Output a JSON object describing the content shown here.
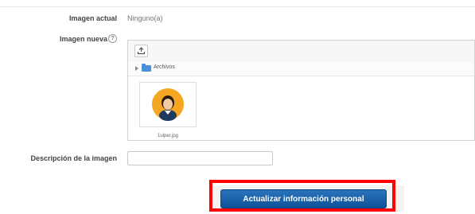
{
  "form": {
    "current_image": {
      "label": "Imagen actual",
      "value": "Ninguno(a)"
    },
    "new_image": {
      "label": "Imagen nueva",
      "help_icon": "question-circle-icon",
      "help_glyph": "?",
      "filepicker": {
        "upload_icon": "upload-icon",
        "path_label": "Archivos",
        "folder_icon": "folder-icon",
        "file": {
          "name": "1ulper.jpg",
          "thumbnail_icon": "user-avatar-icon"
        }
      }
    },
    "image_description": {
      "label": "Descripción de la imagen",
      "value": ""
    },
    "submit": {
      "label": "Actualizar información personal"
    }
  },
  "colors": {
    "primary_button": "#0e5298",
    "highlight_outline": "#ff0000",
    "avatar_background": "#f5a623",
    "folder": "#4a90d9"
  }
}
